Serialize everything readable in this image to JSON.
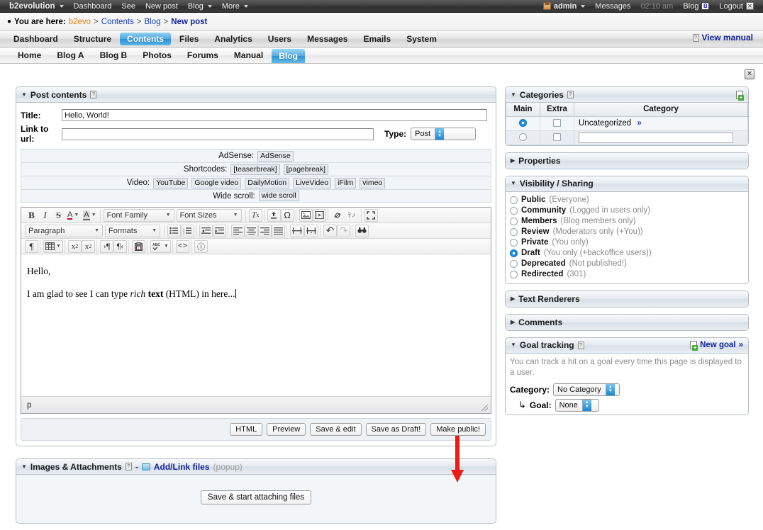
{
  "evobar": {
    "brand": "b2evolution",
    "left_items": [
      "Dashboard",
      "See",
      "New post",
      "Blog",
      "More"
    ],
    "user": "admin",
    "messages": "Messages",
    "time": "02:10 am",
    "blog": "Blog",
    "blog_badge": "B",
    "logout": "Logout",
    "close_glyph": "✕"
  },
  "breadcrumb": {
    "prefix": "You are here:",
    "items": [
      "b2evo",
      "Contents",
      "Blog",
      "New post"
    ],
    "separator": ">",
    "view_manual": "View manual"
  },
  "tabs_primary": [
    {
      "label": "Dashboard",
      "active": false
    },
    {
      "label": "Structure",
      "active": false
    },
    {
      "label": "Contents",
      "active": true
    },
    {
      "label": "Files",
      "active": false
    },
    {
      "label": "Analytics",
      "active": false
    },
    {
      "label": "Users",
      "active": false
    },
    {
      "label": "Messages",
      "active": false
    },
    {
      "label": "Emails",
      "active": false
    },
    {
      "label": "System",
      "active": false
    }
  ],
  "tabs_secondary": [
    {
      "label": "Home",
      "active": false
    },
    {
      "label": "Blog A",
      "active": false
    },
    {
      "label": "Blog B",
      "active": false
    },
    {
      "label": "Photos",
      "active": false
    },
    {
      "label": "Forums",
      "active": false
    },
    {
      "label": "Manual",
      "active": false
    },
    {
      "label": "Blog",
      "active": true
    }
  ],
  "post_contents": {
    "title": "Post contents",
    "field_title_label": "Title:",
    "field_title_value": "Hello, World!",
    "field_url_label": "Link to url:",
    "field_url_value": "",
    "type_label": "Type:",
    "type_value": "Post",
    "ribbons": [
      {
        "label": "AdSense:",
        "chips": [
          "AdSense"
        ]
      },
      {
        "label": "Shortcodes:",
        "chips": [
          "[teaserbreak]",
          "[pagebreak]"
        ]
      },
      {
        "label": "Video:",
        "chips": [
          "YouTube",
          "Google video",
          "DailyMotion",
          "LiveVideo",
          "iFilm",
          "vimeo"
        ]
      },
      {
        "label": "Wide scroll:",
        "chips": [
          "wide scroll"
        ]
      }
    ]
  },
  "editor": {
    "toolbar_row1": [
      {
        "group": 1,
        "name": "bold",
        "glyph": "B",
        "style": "bold"
      },
      {
        "group": 1,
        "name": "italic",
        "glyph": "I",
        "style": "italic"
      },
      {
        "group": 1,
        "name": "strikethrough",
        "glyph": "S",
        "style": "strike"
      },
      {
        "group": 1,
        "name": "text-color",
        "glyph": "A",
        "style": "underline-red",
        "caret": true
      },
      {
        "group": 1,
        "name": "background-color",
        "glyph": "A",
        "style": "highlight",
        "caret": true
      },
      {
        "group": 2,
        "name": "font-family",
        "glyph": "Font Family",
        "style": "dropdown"
      },
      {
        "group": 2,
        "name": "font-sizes",
        "glyph": "Font Sizes",
        "style": "dropdown"
      },
      {
        "group": 3,
        "name": "clear-formatting",
        "glyph": "✕",
        "style": "tx"
      },
      {
        "group": 4,
        "name": "insert-upload",
        "glyph": "⤒"
      },
      {
        "group": 4,
        "name": "special-character",
        "glyph": "Ω"
      },
      {
        "group": 5,
        "name": "insert-image",
        "glyph": "image"
      },
      {
        "group": 5,
        "name": "insert-video",
        "glyph": "video"
      },
      {
        "group": 6,
        "name": "insert-link",
        "glyph": "link"
      },
      {
        "group": 6,
        "name": "unlink",
        "glyph": "unlink"
      },
      {
        "group": 7,
        "name": "fullscreen",
        "glyph": "fullscreen"
      }
    ],
    "toolbar_row2": [
      {
        "name": "paragraph-style",
        "glyph": "Paragraph",
        "style": "dropdown"
      },
      {
        "name": "formats",
        "glyph": "Formats",
        "style": "dropdown"
      },
      {
        "name": "bullet-list",
        "glyph": "bullets"
      },
      {
        "name": "numbered-list",
        "glyph": "numbers"
      },
      {
        "name": "outdent",
        "glyph": "outdent"
      },
      {
        "name": "indent",
        "glyph": "indent"
      },
      {
        "name": "align-left",
        "glyph": "align-left"
      },
      {
        "name": "align-center",
        "glyph": "align-center"
      },
      {
        "name": "align-right",
        "glyph": "align-right"
      },
      {
        "name": "align-justify",
        "glyph": "align-justify"
      },
      {
        "name": "insert-teaserbreak",
        "glyph": "hr1"
      },
      {
        "name": "insert-pagebreak",
        "glyph": "hr2"
      },
      {
        "name": "undo",
        "glyph": "↶"
      },
      {
        "name": "redo",
        "glyph": "↷"
      },
      {
        "name": "search-replace",
        "glyph": "binoculars"
      }
    ],
    "toolbar_row3": [
      {
        "name": "show-invisible-characters",
        "glyph": "¶"
      },
      {
        "name": "table",
        "glyph": "table",
        "caret": true
      },
      {
        "name": "subscript",
        "glyph": "x₂"
      },
      {
        "name": "superscript",
        "glyph": "x²"
      },
      {
        "name": "ltr-direction",
        "glyph": "ltr"
      },
      {
        "name": "rtl-direction",
        "glyph": "rtl"
      },
      {
        "name": "paste-as-text",
        "glyph": "paste"
      },
      {
        "name": "spellcheck",
        "glyph": "ABC",
        "caret": true
      },
      {
        "name": "source-code",
        "glyph": "<>"
      },
      {
        "name": "help",
        "glyph": "?"
      }
    ],
    "content_line1": "Hello,",
    "content_line2_pre": "I am glad to see I can type ",
    "content_line2_italic": "rich",
    "content_line2_bold": "text",
    "content_line2_post": " (HTML) in here...",
    "status_path": "p",
    "buttons": [
      {
        "label": "HTML",
        "name": "html-button"
      },
      {
        "label": "Preview",
        "name": "preview-button"
      },
      {
        "label": "Save & edit",
        "name": "save-and-edit-button"
      },
      {
        "label": "Save as Draft!",
        "name": "save-as-draft-button"
      },
      {
        "label": "Make public!",
        "name": "make-public-button"
      }
    ]
  },
  "categories": {
    "title": "Categories",
    "headers": [
      "Main",
      "Extra",
      "Category"
    ],
    "rows": [
      {
        "main_selected": true,
        "extra_checked": false,
        "name": "Uncategorized",
        "chevron": "»",
        "is_input": false
      },
      {
        "main_selected": false,
        "extra_checked": false,
        "name": "",
        "chevron": "",
        "is_input": true
      }
    ]
  },
  "properties": {
    "title": "Properties"
  },
  "visibility": {
    "title": "Visibility / Sharing",
    "options": [
      {
        "name": "Public",
        "desc": "(Everyone)",
        "selected": false
      },
      {
        "name": "Community",
        "desc": "(Logged in users only)",
        "selected": false
      },
      {
        "name": "Members",
        "desc": "(Blog members only)",
        "selected": false
      },
      {
        "name": "Review",
        "desc": "(Moderators only (+You))",
        "selected": false
      },
      {
        "name": "Private",
        "desc": "(You only)",
        "selected": false
      },
      {
        "name": "Draft",
        "desc": "(You only (+backoffice users))",
        "selected": true
      },
      {
        "name": "Deprecated",
        "desc": "(Not published!)",
        "selected": false
      },
      {
        "name": "Redirected",
        "desc": "(301)",
        "selected": false
      }
    ]
  },
  "text_renderers": {
    "title": "Text Renderers"
  },
  "comments": {
    "title": "Comments"
  },
  "goal_tracking": {
    "title": "Goal tracking",
    "new_goal": "New goal",
    "new_goal_chevron": "»",
    "note": "You can track a hit on a goal every time this page is displayed to a user.",
    "category_label": "Category:",
    "category_value": "No Category",
    "goal_label": "Goal:",
    "goal_value": "None",
    "goal_arrow": "↳"
  },
  "attachments": {
    "title": "Images & Attachments",
    "dash": "-",
    "add_link": "Add/Link files",
    "popup_note": "(popup)",
    "save_button": "Save & start attaching files"
  },
  "colors": {
    "accent_blue": "#2b8fd4",
    "link_blue": "#10239e",
    "orange": "#e8820c",
    "arrow_red": "#ee1c15"
  }
}
